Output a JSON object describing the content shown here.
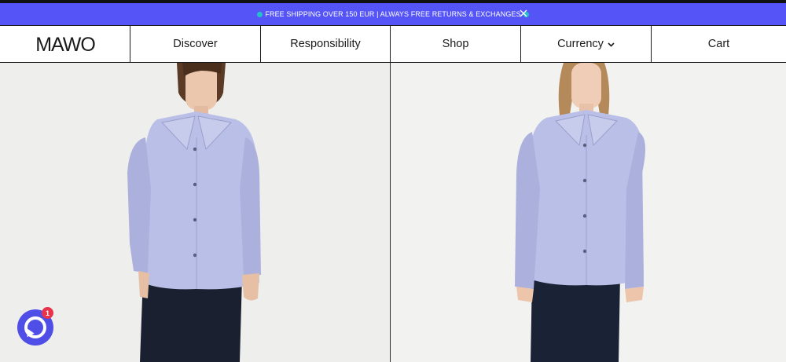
{
  "banner": {
    "text": "FREE SHIPPING OVER 150 EUR | ALWAYS FREE RETURNS & EXCHANGES",
    "background": "#5555f7",
    "dot_color": "#25c1c9",
    "close_icon": "close-icon"
  },
  "nav": {
    "logo": "MAWO",
    "items": [
      {
        "label": "Discover"
      },
      {
        "label": "Responsibility"
      },
      {
        "label": "Shop"
      },
      {
        "label": "Currency",
        "icon": "chevron-down-icon"
      },
      {
        "label": "Cart"
      }
    ]
  },
  "hero": {
    "left_image": "model-in-lavender-shirt-front",
    "right_image": "model-in-lavender-shirt-front-long-hair",
    "shirt_color": "#b9bfe6"
  },
  "chat": {
    "icon": "chat-bubble-icon",
    "badge_count": "1",
    "color": "#4f4fe8",
    "badge_color": "#e8334a"
  }
}
